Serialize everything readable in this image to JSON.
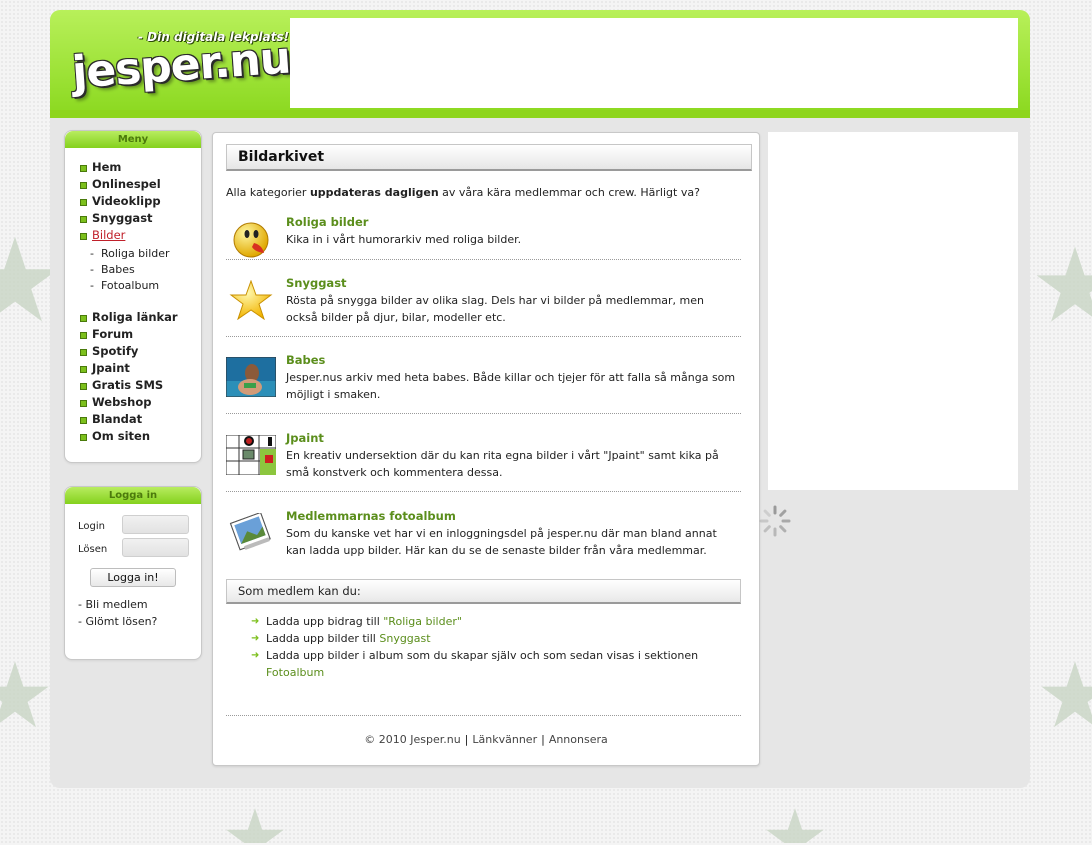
{
  "header": {
    "tagline": "- Din digitala lekplats!",
    "logo": "jesper.nu"
  },
  "menu": {
    "title": "Meny",
    "items": [
      "Hem",
      "Onlinespel",
      "Videoklipp",
      "Snyggast",
      "Bilder"
    ],
    "active": "Bilder",
    "subitems": [
      "Roliga bilder",
      "Babes",
      "Fotoalbum"
    ],
    "items2": [
      "Roliga länkar",
      "Forum",
      "Spotify",
      "Jpaint",
      "Gratis SMS",
      "Webshop",
      "Blandat",
      "Om siten"
    ]
  },
  "login": {
    "title": "Logga in",
    "login_label": "Login",
    "password_label": "Lösen",
    "button": "Logga in!",
    "links": [
      "- Bli medlem",
      "- Glömt lösen?"
    ]
  },
  "content": {
    "heading": "Bildarkivet",
    "intro_pre": "Alla kategorier ",
    "intro_bold": "uppdateras dagligen",
    "intro_post": " av våra kära medlemmar och crew. Härligt va?",
    "categories": [
      {
        "title": "Roliga bilder",
        "desc": "Kika in i vårt humorarkiv med roliga bilder.",
        "icon": "smiley-icon"
      },
      {
        "title": "Snyggast",
        "desc": "Rösta på snygga bilder av olika slag. Dels har vi bilder på medlemmar, men också bilder på djur, bilar, modeller etc.",
        "icon": "star-icon"
      },
      {
        "title": "Babes",
        "desc": "Jesper.nus arkiv med heta babes. Både killar och tjejer för att falla så många som möjligt i smaken.",
        "icon": "photo-icon"
      },
      {
        "title": "Jpaint",
        "desc": "En kreativ undersektion där du kan rita egna bilder i vårt \"Jpaint\" samt kika på små konstverk och kommentera dessa.",
        "icon": "paint-icon"
      },
      {
        "title": "Medlemmarnas fotoalbum",
        "desc": "Som du kanske vet har vi en inloggningsdel på jesper.nu där man bland annat kan ladda upp bilder. Här kan du se de senaste bilder från våra medlemmar.",
        "icon": "album-icon"
      }
    ],
    "subheading": "Som medlem kan du:",
    "perks": {
      "p1_text": "Ladda upp bidrag till ",
      "p1_link": "\"Roliga bilder\"",
      "p2_text": "Ladda upp bilder till ",
      "p2_link": "Snyggast",
      "p3_text": "Ladda upp bilder i album som du skapar själv och som sedan visas i sektionen ",
      "p3_link": "Fotoalbum"
    }
  },
  "footer": {
    "copyright": "© 2010 Jesper.nu",
    "link1": "Länkvänner",
    "link2": "Annonsera",
    "sep": "|"
  },
  "colors": {
    "brand_green": "#8ad81e",
    "link_green": "#5b8e1c",
    "active_red": "#c0202a"
  }
}
